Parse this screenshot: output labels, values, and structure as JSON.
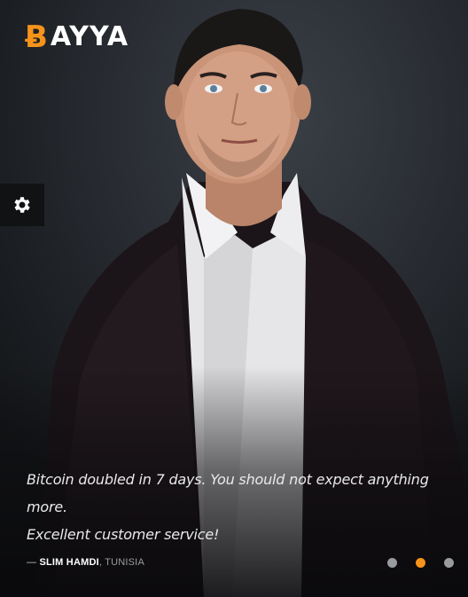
{
  "brand": {
    "logo_text": "AYYA",
    "logo_symbol": "Ƀ",
    "accent_color": "#f7931a"
  },
  "settings": {
    "icon": "gear-icon"
  },
  "testimonial": {
    "line1": "Bitcoin doubled in 7 days. You should not expect anything more.",
    "line2": "Excellent customer service!",
    "dash": "—",
    "author_name": "SLIM HAMDI",
    "separator": ",",
    "author_location": "TUNISIA"
  },
  "carousel": {
    "total_slides": 3,
    "active_index": 1
  }
}
